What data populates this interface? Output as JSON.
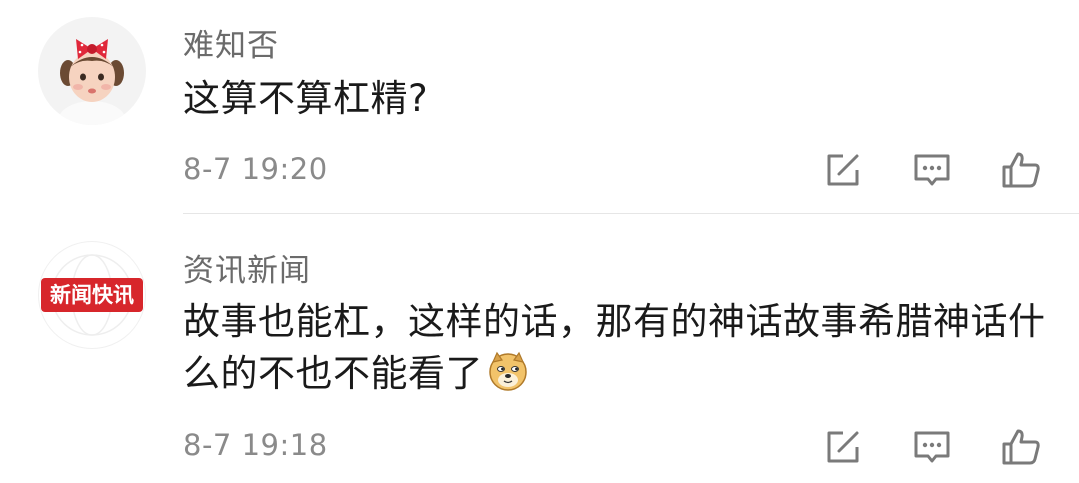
{
  "colors": {
    "username": "#6b6b6b",
    "content": "#1a1a1a",
    "time": "#8a8a8a",
    "icon": "#7a7a7a",
    "news_logo_red": "#d7262b",
    "divider": "#e6e6e6"
  },
  "comments": [
    {
      "username": "难知否",
      "avatar_icon": "baby-girl-avatar",
      "content": "这算不算杠精?",
      "time": "8-7 19:20",
      "actions": [
        "share-icon",
        "reply-icon",
        "like-icon"
      ]
    },
    {
      "username": "资讯新闻",
      "avatar_icon": "news-logo-avatar",
      "avatar_text": "新闻快讯",
      "content": "故事也能杠，这样的话，那有的神话故事希腊神话什么的不也不能看了",
      "emoji": "doge-emoji",
      "time": "8-7 19:18",
      "actions": [
        "share-icon",
        "reply-icon",
        "like-icon"
      ]
    }
  ]
}
